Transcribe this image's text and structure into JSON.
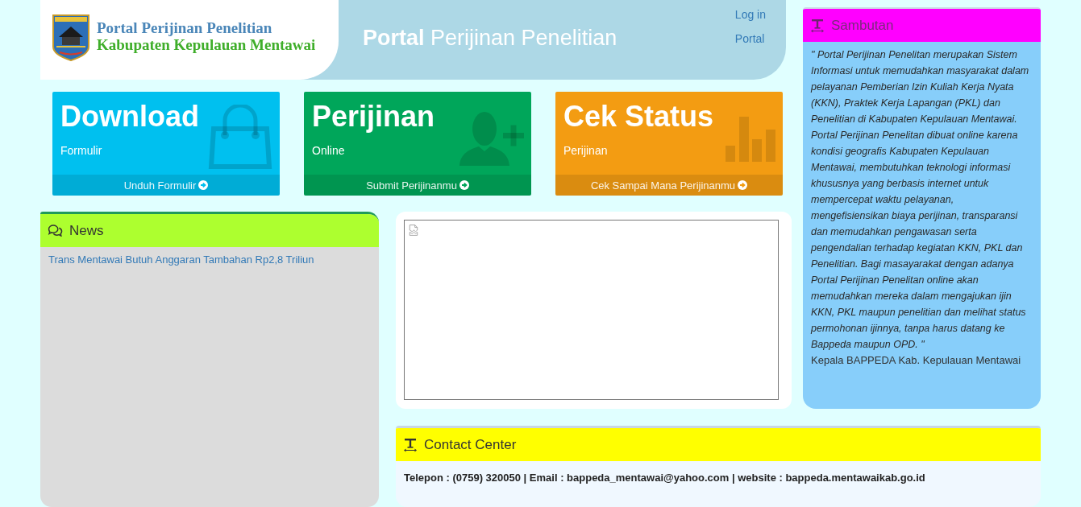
{
  "header": {
    "logo": {
      "line_1": "Portal Perijinan Penelitian",
      "line_2": "Kabupaten Kepulauan Mentawai"
    },
    "title": "**Portal** Perijinan Penelitian",
    "links": [
      "Log in",
      "Portal"
    ]
  },
  "tiles": [
    {
      "kind": "bag",
      "color": "#00c0ef",
      "title": "Download",
      "subtitle": "Formulir",
      "link": "Unduh Formulir"
    },
    {
      "kind": "user-plus",
      "color": "#00a65a",
      "title": "Perijinan",
      "subtitle": "Online",
      "link": "Submit Perijinanmu"
    },
    {
      "kind": "bar-chart",
      "color": "#f39c12",
      "title": "Cek Status",
      "subtitle": "Perijinan",
      "link": "Cek Sampai Mana Perijinanmu"
    }
  ],
  "news": {
    "title": "News",
    "items": [
      "Trans Mentawai Butuh Anggaran Tambahan Rp2,8 Triliun"
    ]
  },
  "sambutan": {
    "title": "Sambutan",
    "quote": "\" Portal Perijinan Penelitan merupakan Sistem Informasi untuk memudahkan masyarakat dalam pelayanan Pemberian Izin Kuliah Kerja Nyata (KKN), Praktek Kerja Lapangan (PKL) dan Penelitian di Kabupaten Kepulauan Mentawai. Portal Perijinan Penelitan dibuat online karena kondisi geografis Kabupaten Kepulauan Mentawai, membutuhkan teknologi informasi khususnya yang berbasis internet untuk mempercepat waktu pelayanan, mengefisiensikan biaya perijinan, transparansi dan memudahkan pengawasan serta pengendalian terhadap kegiatan KKN, PKL dan Penelitian. Bagi masayarakat dengan adanya Portal Perijinan Penelitan online akan memudahkan mereka dalam mengajukan ijin KKN, PKL maupun penelitian dan melihat status permohonan ijinnya, tanpa harus datang ke Bappeda maupun OPD. \"",
    "signature": "Kepala BAPPEDA Kab. Kepulauan Mentawai"
  },
  "contact_center": {
    "title": "Contact Center",
    "text": "Telepon : (0759) 320050 | Email : bappeda_mentawai@yahoo.com | website : bappeda.mentawaikab.go.id"
  }
}
